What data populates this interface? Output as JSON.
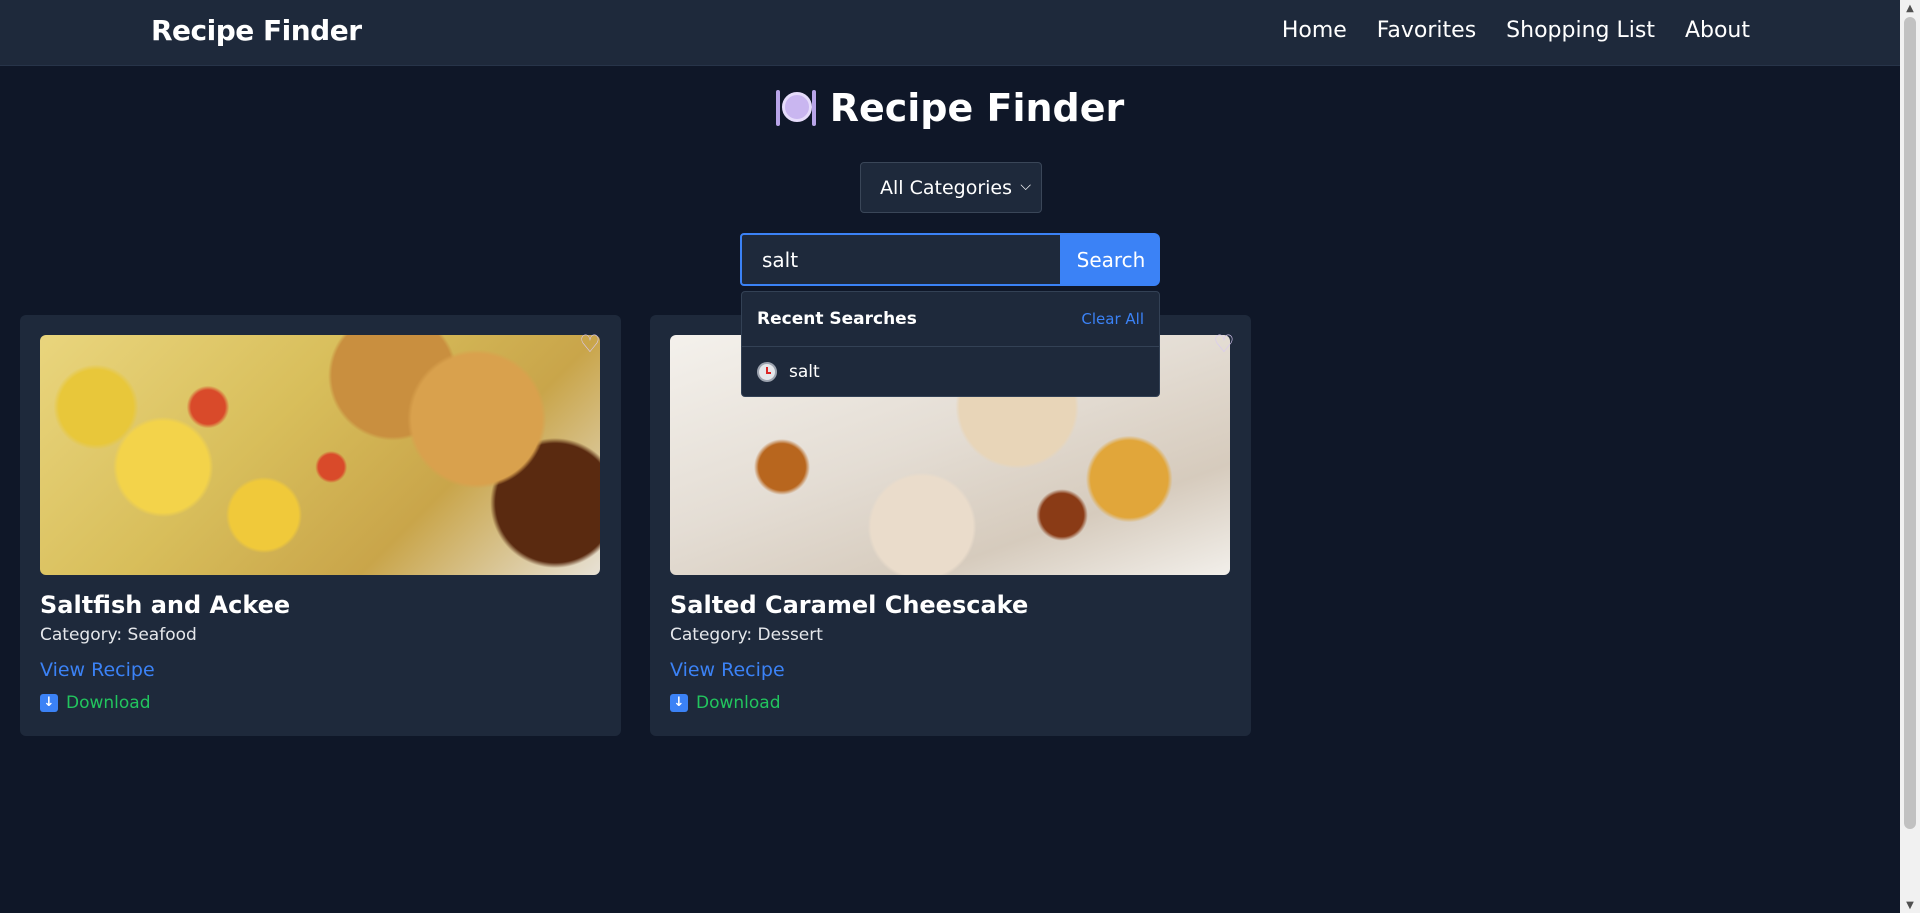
{
  "navbar": {
    "brand": "Recipe Finder",
    "links": [
      "Home",
      "Favorites",
      "Shopping List",
      "About"
    ]
  },
  "header": {
    "title": "Recipe Finder",
    "icon": "plate-with-cutlery-icon"
  },
  "filter": {
    "selected_category": "All Categories"
  },
  "search": {
    "value": "salt",
    "button_label": "Search"
  },
  "recent_searches": {
    "title": "Recent Searches",
    "clear_label": "Clear All",
    "items": [
      "salt"
    ]
  },
  "recipes": [
    {
      "title": "Saltfish and Ackee",
      "category": "Category: Seafood",
      "view_label": "View Recipe",
      "download_label": "Download"
    },
    {
      "title": "Salted Caramel Cheescake",
      "category": "Category: Dessert",
      "view_label": "View Recipe",
      "download_label": "Download"
    }
  ],
  "colors": {
    "background": "#0f1728",
    "surface": "#1e293b",
    "accent": "#3b82f6",
    "download": "#22c55e"
  }
}
